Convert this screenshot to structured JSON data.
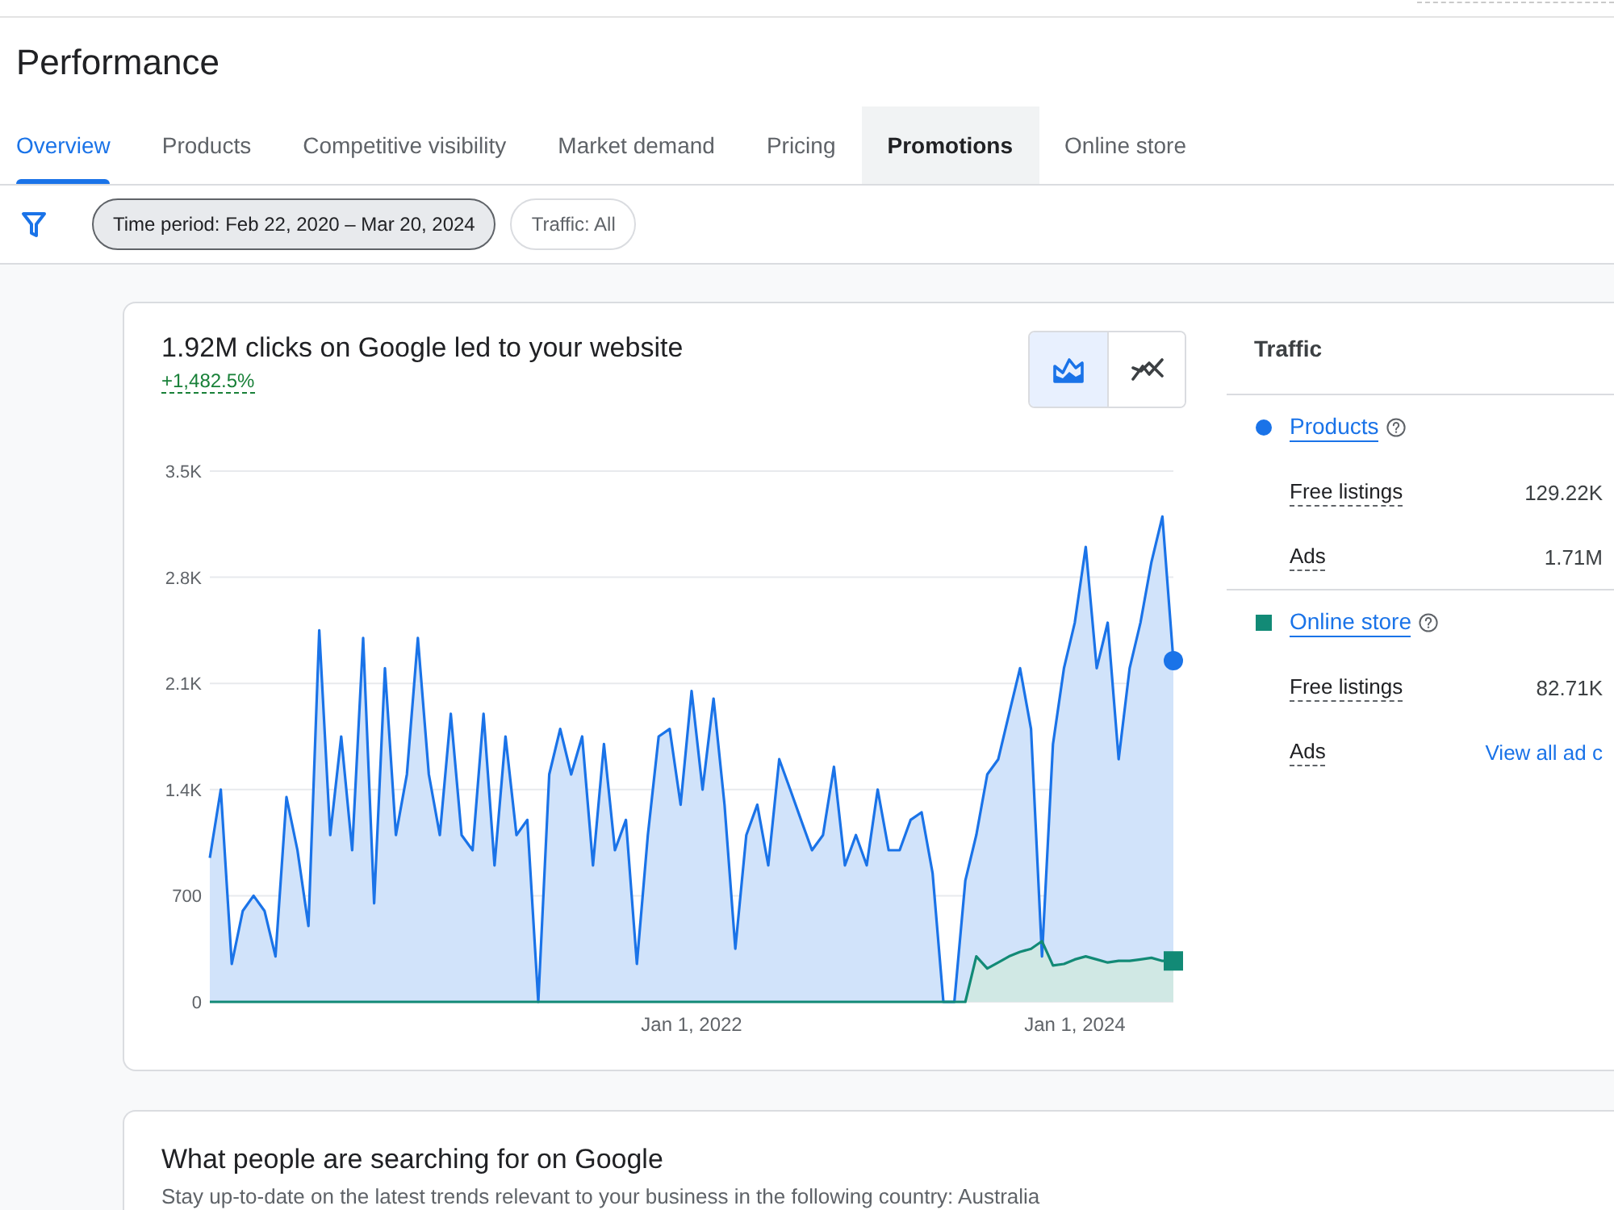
{
  "page": {
    "title": "Performance"
  },
  "tabs": [
    {
      "label": "Overview",
      "selected": true,
      "hovered": false
    },
    {
      "label": "Products",
      "selected": false,
      "hovered": false
    },
    {
      "label": "Competitive visibility",
      "selected": false,
      "hovered": false
    },
    {
      "label": "Market demand",
      "selected": false,
      "hovered": false
    },
    {
      "label": "Pricing",
      "selected": false,
      "hovered": false
    },
    {
      "label": "Promotions",
      "selected": false,
      "hovered": true
    },
    {
      "label": "Online store",
      "selected": false,
      "hovered": false
    }
  ],
  "filters": {
    "chips": [
      {
        "label": "Time period: Feb 22, 2020 – Mar 20, 2024",
        "selected": true
      },
      {
        "label": "Traffic: All",
        "selected": false
      }
    ]
  },
  "clicks_card": {
    "title": "1.92M clicks on Google led to your website",
    "change": "+1,482.5%",
    "view_toggle": [
      {
        "kind": "area",
        "selected": true
      },
      {
        "kind": "line",
        "selected": false
      }
    ],
    "chart_data": {
      "type": "area",
      "grid": true,
      "categories": [
        null,
        null,
        null,
        null,
        null,
        null,
        null,
        null,
        null,
        null,
        null,
        null,
        null,
        null,
        null,
        null,
        null,
        null,
        null,
        null,
        null,
        null,
        null,
        null,
        null,
        null,
        null,
        null,
        null,
        null,
        null,
        null,
        null,
        null,
        null,
        null,
        null,
        null,
        null,
        null,
        null,
        null,
        null,
        null,
        "Jan 1, 2022",
        null,
        null,
        null,
        null,
        null,
        null,
        null,
        null,
        null,
        null,
        null,
        null,
        null,
        null,
        null,
        null,
        null,
        null,
        null,
        null,
        null,
        null,
        null,
        null,
        null,
        null,
        null,
        null,
        null,
        null,
        null,
        null,
        null,
        null,
        "Jan 1, 2024",
        null,
        null,
        null,
        null,
        null,
        null,
        null,
        null,
        null
      ],
      "series": [
        {
          "name": "Products",
          "color": "#1a73e8",
          "values": [
            950,
            1400,
            250,
            600,
            700,
            600,
            300,
            1350,
            1000,
            500,
            2450,
            1100,
            1750,
            1000,
            2400,
            650,
            2200,
            1100,
            1500,
            2400,
            1500,
            1100,
            1900,
            1100,
            1000,
            1900,
            900,
            1750,
            1100,
            1200,
            0,
            1500,
            1800,
            1500,
            1750,
            900,
            1700,
            1000,
            1200,
            250,
            1100,
            1750,
            1800,
            1300,
            2050,
            1400,
            2000,
            1300,
            350,
            1100,
            1300,
            900,
            1600,
            1400,
            1200,
            1000,
            1100,
            1550,
            900,
            1100,
            900,
            1400,
            1000,
            1000,
            1200,
            1250,
            850,
            0,
            0,
            800,
            1100,
            1500,
            1600,
            1900,
            2200,
            1800,
            300,
            1700,
            2200,
            2500,
            3000,
            2200,
            2500,
            1600,
            2200,
            2500,
            2900,
            3200,
            2250
          ]
        },
        {
          "name": "Online store",
          "color": "#128a76",
          "values": [
            0,
            0,
            0,
            0,
            0,
            0,
            0,
            0,
            0,
            0,
            0,
            0,
            0,
            0,
            0,
            0,
            0,
            0,
            0,
            0,
            0,
            0,
            0,
            0,
            0,
            0,
            0,
            0,
            0,
            0,
            0,
            0,
            0,
            0,
            0,
            0,
            0,
            0,
            0,
            0,
            0,
            0,
            0,
            0,
            0,
            0,
            0,
            0,
            0,
            0,
            0,
            0,
            0,
            0,
            0,
            0,
            0,
            0,
            0,
            0,
            0,
            0,
            0,
            0,
            0,
            0,
            0,
            0,
            0,
            0,
            300,
            220,
            260,
            300,
            330,
            350,
            400,
            240,
            250,
            280,
            300,
            280,
            260,
            270,
            270,
            280,
            290,
            270,
            270
          ]
        }
      ],
      "ylim": [
        0,
        3500
      ],
      "yticks": [
        0,
        700,
        {
          "value": 1400,
          "label": "1.4K"
        },
        {
          "value": 2100,
          "label": "2.1K"
        },
        {
          "value": 2800,
          "label": "2.8K"
        },
        {
          "value": 3500,
          "label": "3.5K"
        }
      ]
    },
    "traffic": {
      "title": "Traffic",
      "groups": [
        {
          "kind": "circle",
          "rows": [
            {
              "label": "Free listings",
              "value": "129.22K"
            },
            {
              "label": "Ads",
              "value": "1.71M"
            }
          ]
        },
        {
          "kind": "square",
          "rows": [
            {
              "label": "Free listings",
              "value": "82.71K"
            },
            {
              "label": "Ads",
              "link": "View all ad c"
            }
          ]
        }
      ]
    }
  },
  "trends_card": {
    "title": "What people are searching for on Google",
    "description": "Stay up-to-date on the latest trends relevant to your business in the following country: Australia"
  }
}
